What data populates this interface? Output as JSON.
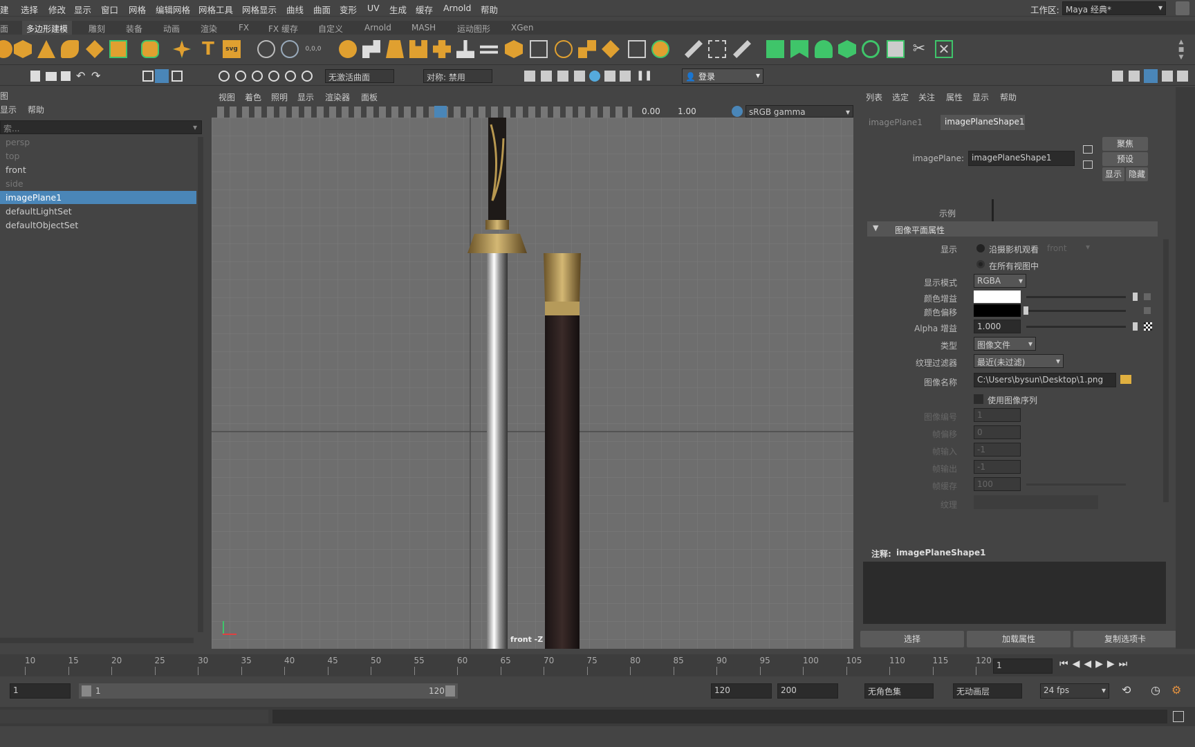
{
  "menubar": {
    "items": [
      "建",
      "选择",
      "修改",
      "显示",
      "窗口",
      "网格",
      "编辑网格",
      "网格工具",
      "网格显示",
      "曲线",
      "曲面",
      "变形",
      "UV",
      "生成",
      "缓存",
      "Arnold",
      "帮助"
    ],
    "workspace_label": "工作区:",
    "workspace_value": "Maya 经典*"
  },
  "shelf_tabs": [
    "面",
    "多边形建模",
    "雕刻",
    "装备",
    "动画",
    "渲染",
    "FX",
    "FX 缓存",
    "自定义",
    "Arnold",
    "MASH",
    "运动图形",
    "XGen"
  ],
  "shelf_active": "多边形建模",
  "status": {
    "live_surface": "无激活曲面",
    "symmetry": "对称: 禁用",
    "login": "登录"
  },
  "outliner": {
    "title": "图",
    "menu": [
      "显示",
      "帮助"
    ],
    "search_placeholder": "索...",
    "items": [
      {
        "label": "persp",
        "dim": true
      },
      {
        "label": "top",
        "dim": true
      },
      {
        "label": "front",
        "dim": false
      },
      {
        "label": "side",
        "dim": true
      },
      {
        "label": "imagePlane1",
        "selected": true
      },
      {
        "label": "defaultLightSet"
      },
      {
        "label": "defaultObjectSet"
      }
    ]
  },
  "viewport": {
    "menu": [
      "视图",
      "着色",
      "照明",
      "显示",
      "渲染器",
      "面板"
    ],
    "exposure": "0.00",
    "gamma": "1.00",
    "color_space": "sRGB gamma",
    "camera_label": "front -Z"
  },
  "attr_editor": {
    "menu": [
      "列表",
      "选定",
      "关注",
      "属性",
      "显示",
      "帮助"
    ],
    "tabs": [
      "imagePlane1",
      "imagePlaneShape1"
    ],
    "node_label": "imagePlane:",
    "node_value": "imagePlaneShape1",
    "btn_focus": "聚焦",
    "btn_preset": "预设",
    "btn_show": "显示",
    "btn_hide": "隐藏",
    "sample_label": "示例",
    "section_title": "图像平面属性",
    "display_label": "显示",
    "display_opt1": "沿摄影机观看",
    "display_cam": "front",
    "display_opt2": "在所有视图中",
    "mode_label": "显示模式",
    "mode_value": "RGBA",
    "color_gain": "颜色增益",
    "color_offset": "颜色偏移",
    "alpha_gain_label": "Alpha 增益",
    "alpha_gain": "1.000",
    "type_label": "类型",
    "type_value": "图像文件",
    "filter_label": "纹理过滤器",
    "filter_value": "最近(未过滤)",
    "image_name_label": "图像名称",
    "image_name_value": "C:\\Users\\bysun\\Desktop\\1.png",
    "use_seq": "使用图像序列",
    "frame_label": "图像编号",
    "frame_value": "1",
    "offset_label": "帧偏移",
    "offset_value": "0",
    "in_label": "帧输入",
    "in_value": "-1",
    "out_label": "帧输出",
    "out_value": "-1",
    "cache_label": "帧缓存",
    "cache_value": "100",
    "texture_label": "纹理",
    "notes_label": "注释:",
    "notes_node": "imagePlaneShape1",
    "btn_select": "选择",
    "btn_load": "加载属性",
    "btn_copy": "复制选项卡"
  },
  "timeline": {
    "ticks": [
      "10",
      "15",
      "20",
      "25",
      "30",
      "35",
      "40",
      "45",
      "50",
      "55",
      "60",
      "65",
      "70",
      "75",
      "80",
      "85",
      "90",
      "95",
      "100",
      "105",
      "110",
      "115",
      "120"
    ],
    "current_frame": "1"
  },
  "range": {
    "start": "1",
    "range_start": "1",
    "range_end": "120",
    "end1": "120",
    "end2": "200",
    "char_set": "无角色集",
    "anim_layer": "无动画层",
    "fps": "24 fps"
  },
  "colors": {
    "accent": "#4a86b8",
    "icon_orange": "#e0a030",
    "icon_green": "#3fc56a"
  }
}
